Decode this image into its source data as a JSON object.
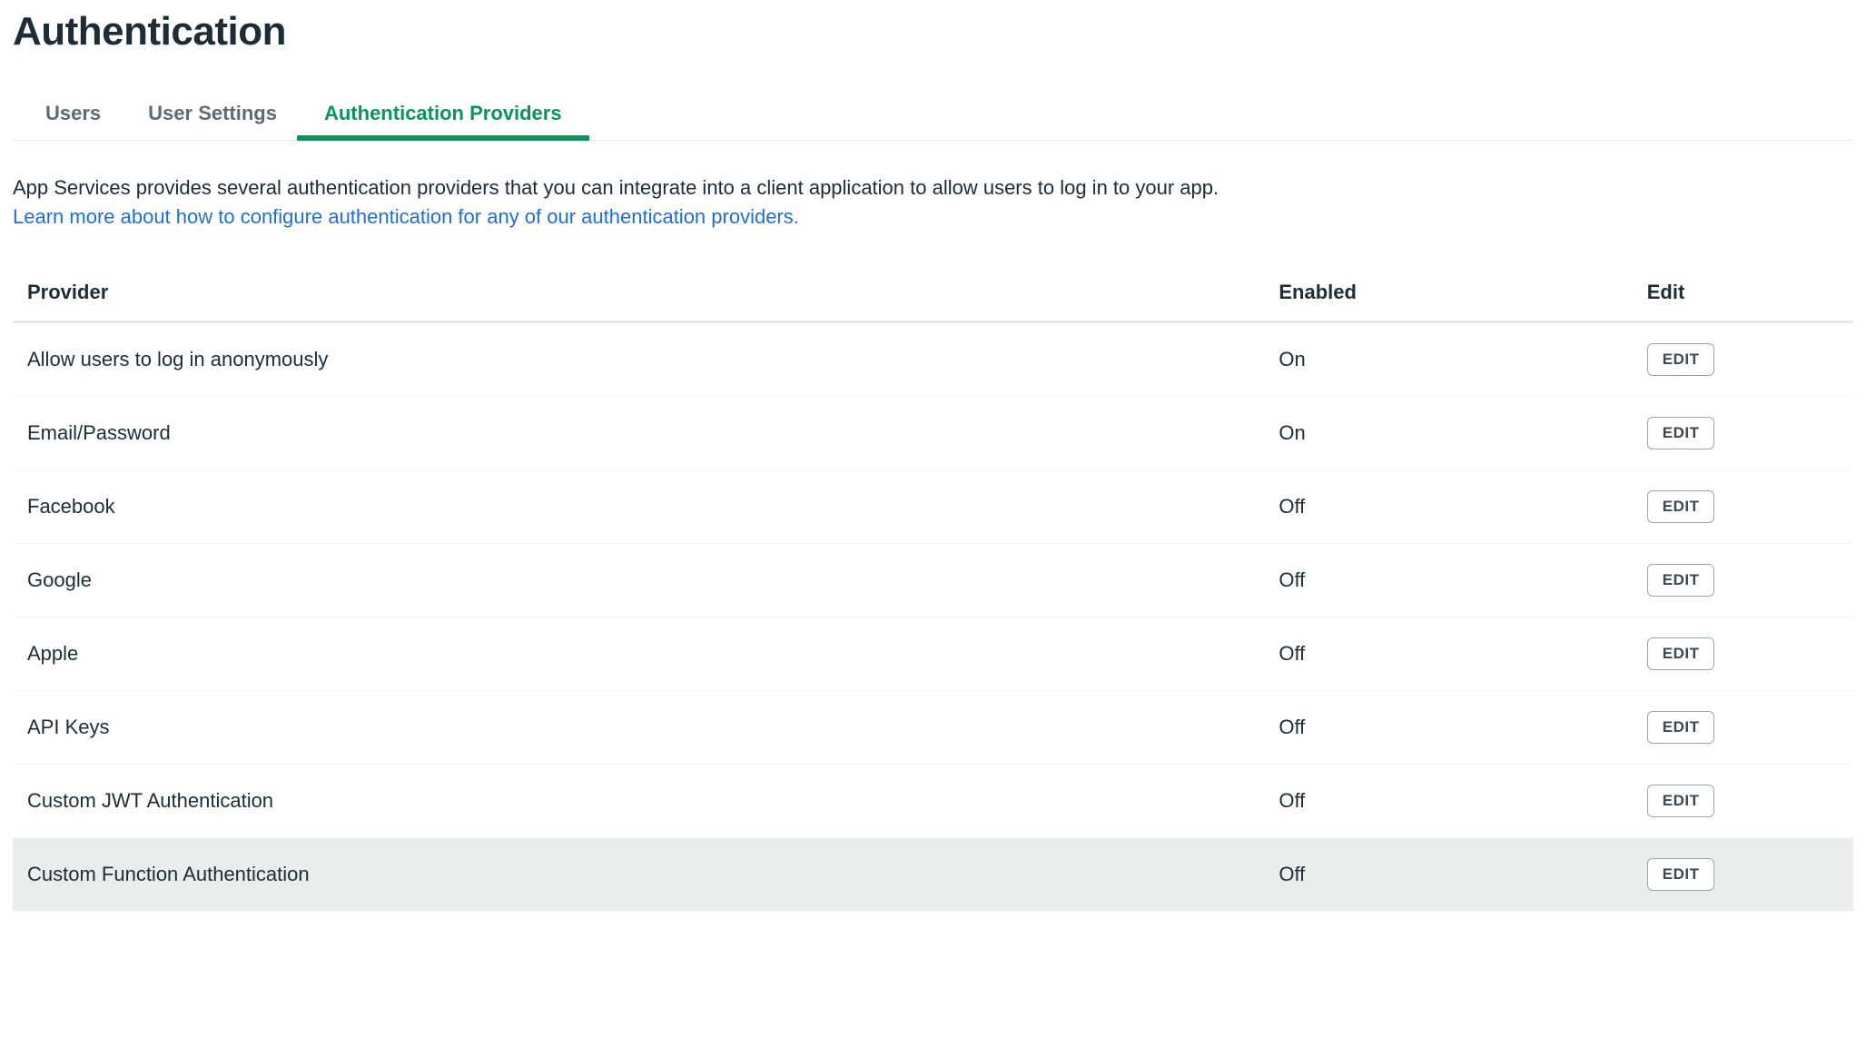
{
  "page_title": "Authentication",
  "tabs": [
    {
      "label": "Users",
      "active": false
    },
    {
      "label": "User Settings",
      "active": false
    },
    {
      "label": "Authentication Providers",
      "active": true
    }
  ],
  "intro_text": "App Services provides several authentication providers that you can integrate into a client application to allow users to log in to your app.",
  "intro_link": "Learn more about how to configure authentication for any of our authentication providers.",
  "columns": {
    "provider": "Provider",
    "enabled": "Enabled",
    "edit": "Edit"
  },
  "status_labels": {
    "on": "On",
    "off": "Off"
  },
  "edit_button_label": "EDIT",
  "providers": [
    {
      "name": "Allow users to log in anonymously",
      "enabled": true,
      "highlight": false
    },
    {
      "name": "Email/Password",
      "enabled": true,
      "highlight": false
    },
    {
      "name": "Facebook",
      "enabled": false,
      "highlight": false
    },
    {
      "name": "Google",
      "enabled": false,
      "highlight": false
    },
    {
      "name": "Apple",
      "enabled": false,
      "highlight": false
    },
    {
      "name": "API Keys",
      "enabled": false,
      "highlight": false
    },
    {
      "name": "Custom JWT Authentication",
      "enabled": false,
      "highlight": false
    },
    {
      "name": "Custom Function Authentication",
      "enabled": false,
      "highlight": true
    }
  ]
}
